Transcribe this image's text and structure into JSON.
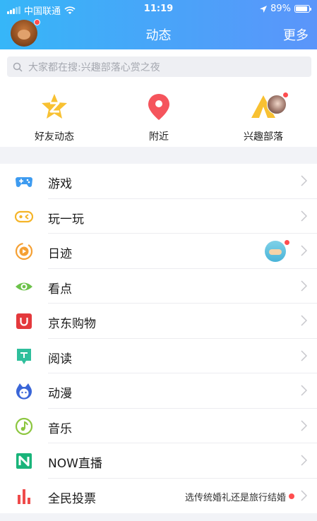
{
  "status_bar": {
    "carrier": "中国联通",
    "time": "11:19",
    "battery": "89%",
    "battery_level": 0.89
  },
  "header": {
    "title": "动态",
    "more": "更多"
  },
  "search": {
    "placeholder": "大家都在搜:兴趣部落心赏之夜"
  },
  "quick": [
    {
      "label": "好友动态",
      "icon": "friend-feed-star-icon"
    },
    {
      "label": "附近",
      "icon": "location-pin-icon"
    },
    {
      "label": "兴趣部落",
      "icon": "tribe-tent-icon"
    }
  ],
  "menu": [
    {
      "label": "游戏",
      "icon": "gamepad-icon"
    },
    {
      "label": "玩一玩",
      "icon": "play-controller-icon"
    },
    {
      "label": "日迹",
      "icon": "daily-trace-icon"
    },
    {
      "label": "看点",
      "icon": "eye-icon"
    },
    {
      "label": "京东购物",
      "icon": "shopping-bag-icon"
    },
    {
      "label": "阅读",
      "icon": "book-icon"
    },
    {
      "label": "动漫",
      "icon": "anime-icon"
    },
    {
      "label": "音乐",
      "icon": "music-note-icon"
    },
    {
      "label": "NOW直播",
      "icon": "now-live-icon"
    },
    {
      "label": "全民投票",
      "icon": "vote-bars-icon",
      "extra": "选传统婚礼还是旅行结婚"
    }
  ],
  "colors": {
    "header_start": "#36b6f8",
    "header_end": "#5b95fa",
    "badge": "#ff4d4f"
  }
}
